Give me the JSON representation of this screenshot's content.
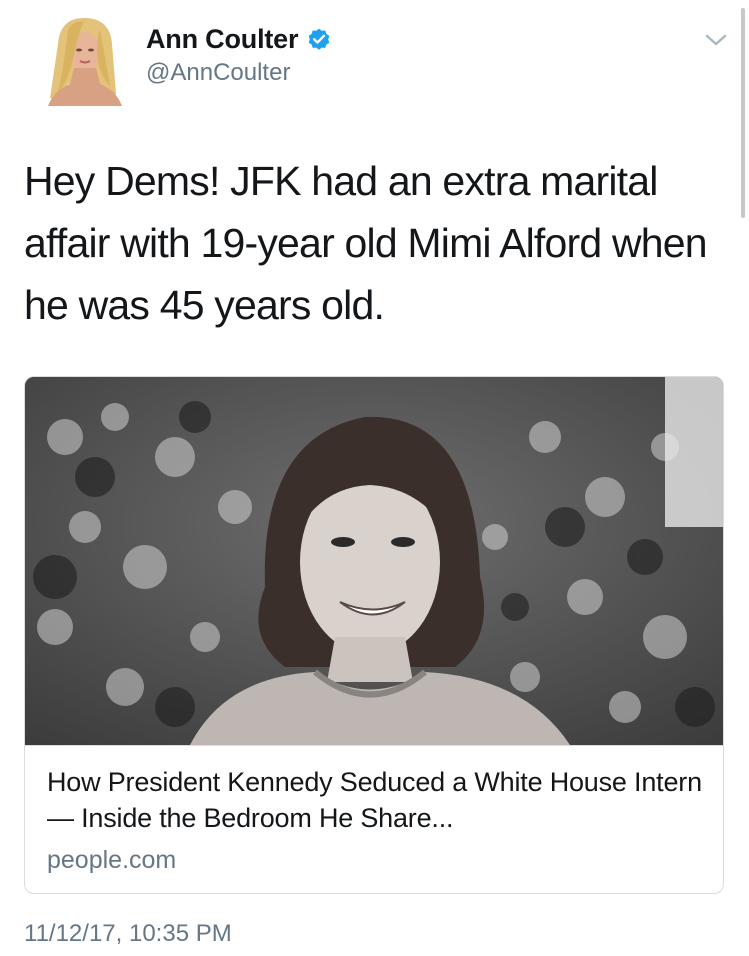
{
  "author": {
    "name": "Ann Coulter",
    "handle": "@AnnCoulter",
    "verified_color": "#1da1f2"
  },
  "icons": {
    "verified": "verified-badge-icon",
    "menu": "chevron-down-icon"
  },
  "tweet": {
    "text": "Hey Dems!  JFK had an extra marital\naffair with 19-year old Mimi Alford when\nhe was 45 years old.",
    "timestamp": "11/12/17, 10:35 PM"
  },
  "card": {
    "title": "How President Kennedy Seduced a White House Intern — Inside the Bedroom He Share...",
    "domain": "people.com"
  },
  "colors": {
    "text": "#14171a",
    "secondary": "#657786",
    "border": "#d6dee3"
  }
}
